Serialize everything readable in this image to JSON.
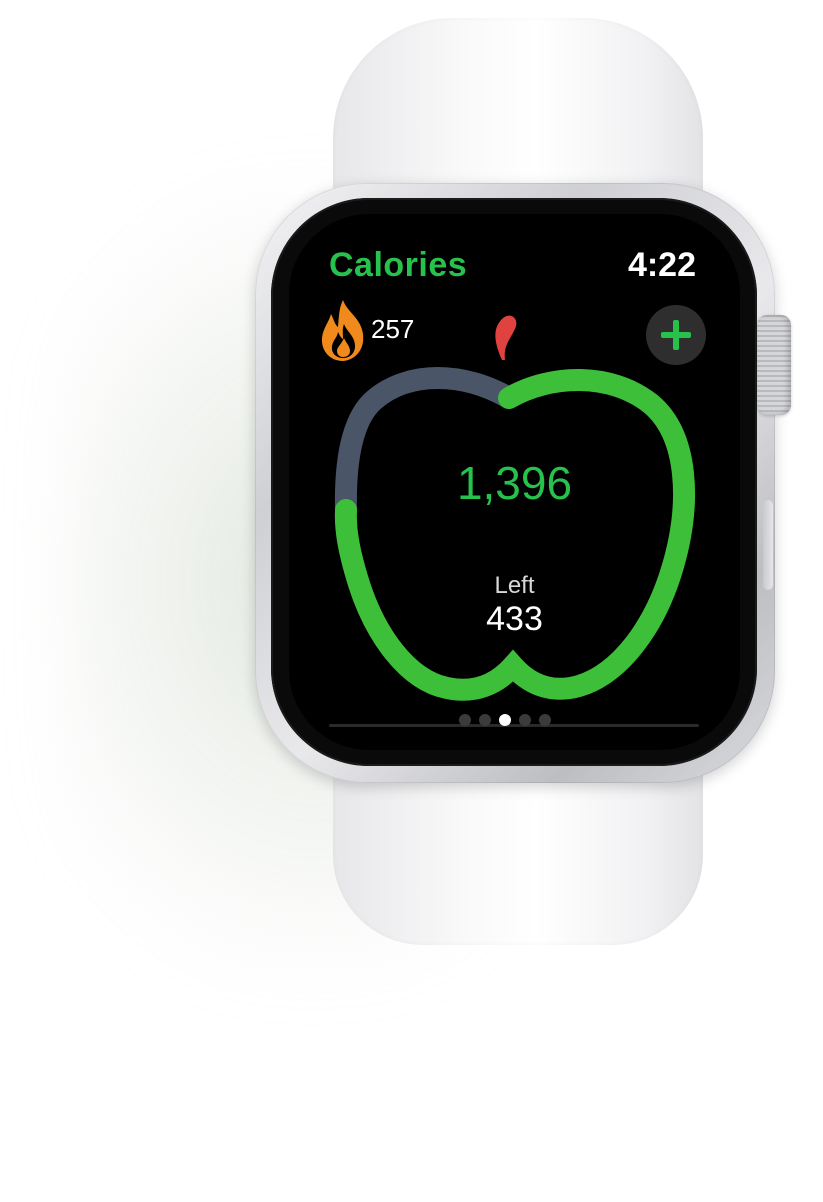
{
  "screen": {
    "title": "Calories",
    "time": "4:22"
  },
  "burned": {
    "icon": "flame-icon",
    "value": "257"
  },
  "add_button": {
    "icon": "plus-icon"
  },
  "ring": {
    "consumed_value": "1,396",
    "remaining_label": "Left",
    "remaining_value": "433",
    "colors": {
      "progress": "#3ebf3a",
      "track": "#4a5568",
      "stem": "#e0423f"
    }
  },
  "page_indicator": {
    "count": 5,
    "active_index": 2
  },
  "colors": {
    "accent": "#27c24c",
    "flame": "#f08a1c",
    "background": "#000000"
  }
}
